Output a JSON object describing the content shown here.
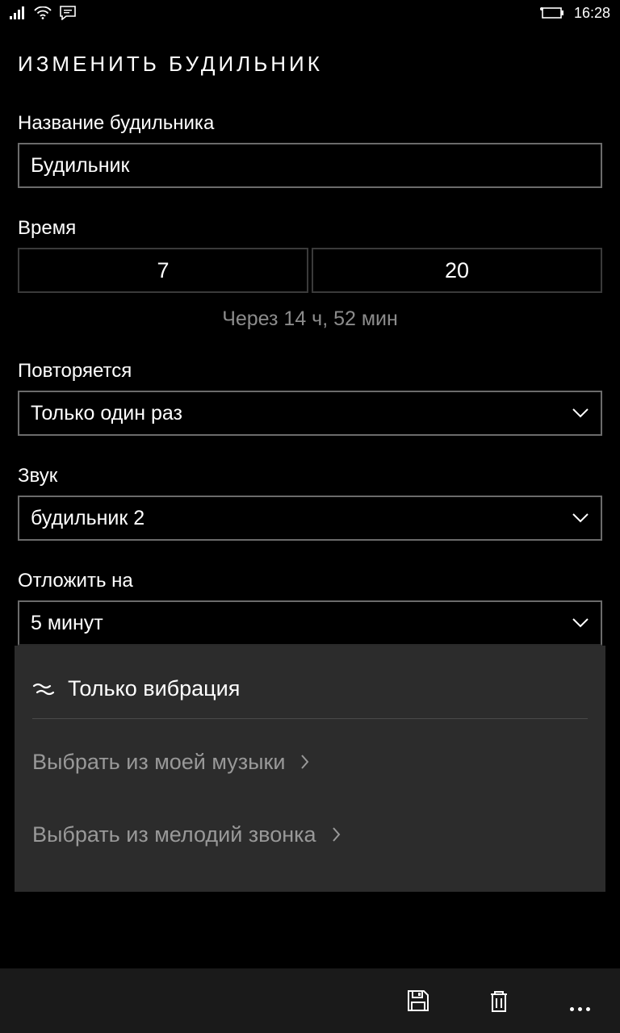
{
  "status": {
    "time": "16:28"
  },
  "pageTitle": "ИЗМЕНИТЬ БУДИЛЬНИК",
  "nameField": {
    "label": "Название будильника",
    "value": "Будильник"
  },
  "timeField": {
    "label": "Время",
    "hours": "7",
    "minutes": "20",
    "until": "Через 14 ч, 52 мин"
  },
  "repeatField": {
    "label": "Повторяется",
    "value": "Только один раз"
  },
  "soundField": {
    "label": "Звук",
    "value": "будильник 2"
  },
  "snoozeField": {
    "label": "Отложить на",
    "value": "5 минут"
  },
  "flyout": {
    "vibration": "Только вибрация",
    "myMusic": "Выбрать из моей музыки",
    "ringtones": "Выбрать из мелодий звонка"
  }
}
